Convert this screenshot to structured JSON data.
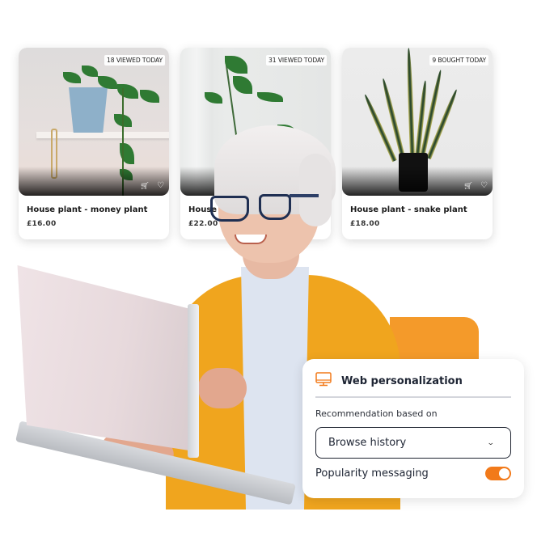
{
  "products": [
    {
      "badge": "18 VIEWED TODAY",
      "title": "House plant - money plant",
      "price": "£16.00"
    },
    {
      "badge": "31 VIEWED TODAY",
      "title": "House plant - money plant",
      "price": "£22.00"
    },
    {
      "badge": "9 BOUGHT TODAY",
      "title": "House plant - snake plant",
      "price": "£18.00"
    }
  ],
  "icons": {
    "cart": "🛒",
    "heart": "♡",
    "chevron": "⌄"
  },
  "panel": {
    "title": "Web personalization",
    "icon": "monitor-icon",
    "recommendation_label": "Recommendation based on",
    "recommendation_value": "Browse history",
    "popularity_label": "Popularity messaging",
    "popularity_enabled": true
  },
  "colors": {
    "accent": "#f27a1a",
    "accent_block": "#f49a2a",
    "cardigan": "#f0a51e",
    "text": "#1d2433"
  }
}
